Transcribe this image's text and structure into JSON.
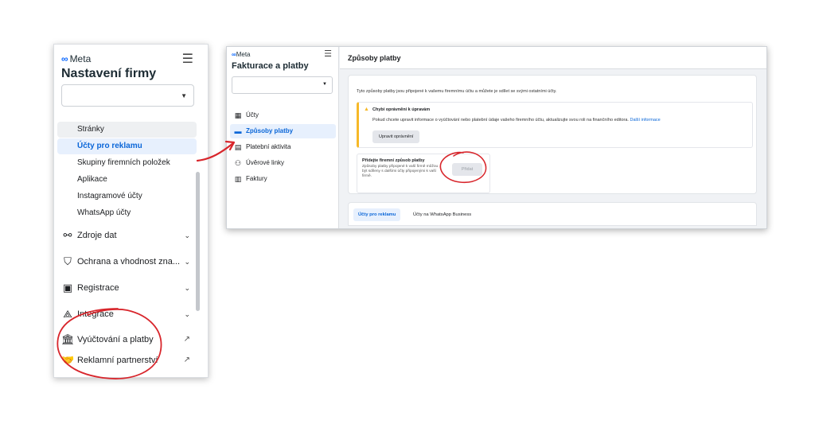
{
  "left_panel": {
    "logo": "Meta",
    "title": "Nastavení firmy",
    "sub_items": [
      "Stránky",
      "Účty pro reklamu",
      "Skupiny firemních položek",
      "Aplikace",
      "Instagramové účty",
      "WhatsApp účty"
    ],
    "sections": [
      {
        "label": "Zdroje dat",
        "icon": "data-sources-icon"
      },
      {
        "label": "Ochrana a vhodnost zna...",
        "icon": "shield-icon"
      },
      {
        "label": "Registrace",
        "icon": "clipboard-icon"
      },
      {
        "label": "Integrace",
        "icon": "integrations-icon"
      },
      {
        "label": "Vyúčtování a platby",
        "icon": "bank-icon"
      },
      {
        "label": "Reklamní partnerství",
        "icon": "handshake-icon"
      }
    ]
  },
  "right_panel": {
    "logo": "Meta",
    "title": "Fakturace a platby",
    "nav": [
      {
        "label": "Účty",
        "icon": "accounts-icon"
      },
      {
        "label": "Způsoby platby",
        "icon": "card-icon"
      },
      {
        "label": "Platební aktivita",
        "icon": "activity-icon"
      },
      {
        "label": "Úvěrové linky",
        "icon": "credit-icon"
      },
      {
        "label": "Faktury",
        "icon": "invoice-icon"
      }
    ],
    "header": "Způsoby platby",
    "intro": "Tyto způsoby platby jsou připojené k vašemu firemnímu účtu a můžete je sdílet se svými ostatními účty.",
    "warning": {
      "title": "Chybí oprávnění k úpravám",
      "text": "Pokud chcete upravit informace o vyúčtování nebo platební údaje vašeho firemního účtu, aktualizujte svou roli na finančního editora.",
      "link": "Další informace",
      "button": "Upravit oprávnění"
    },
    "add_box": {
      "title": "Přidejte firemní způsob platby",
      "desc": "Způsoby platby připojené k vaší firmě můžou být sdíleny s dalšími účty připojenými k vaší firmě.",
      "button": "Přidat"
    },
    "tabs": [
      "Účty pro reklamu",
      "Účty na WhatsApp Business"
    ]
  },
  "colors": {
    "accent": "#0a66d8",
    "warning": "#f7b928",
    "annotation": "#d8262c"
  }
}
